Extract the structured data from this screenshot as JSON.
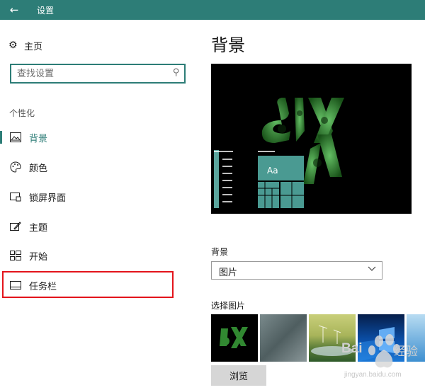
{
  "window": {
    "back_glyph": "←",
    "title": "设置"
  },
  "sidebar": {
    "home_label": "主页",
    "search_placeholder": "查找设置",
    "section_label": "个性化",
    "items": [
      {
        "label": "背景",
        "icon": "image-icon",
        "active": true
      },
      {
        "label": "颜色",
        "icon": "palette-icon",
        "active": false
      },
      {
        "label": "锁屏界面",
        "icon": "lock-screen-icon",
        "active": false
      },
      {
        "label": "主题",
        "icon": "theme-icon",
        "active": false
      },
      {
        "label": "开始",
        "icon": "start-icon",
        "active": false
      },
      {
        "label": "任务栏",
        "icon": "taskbar-icon",
        "active": false
      }
    ]
  },
  "main": {
    "page_title": "背景",
    "preview_tile_text": "Aa",
    "background_label": "背景",
    "background_select_value": "图片",
    "choose_picture_label": "选择图片",
    "browse_label": "浏览"
  },
  "watermark": {
    "brand": "Bai",
    "product": "经验",
    "url": "jingyan.baidu.com"
  },
  "colors": {
    "accent": "#2d7d77",
    "highlight": "#e3141b",
    "wallpaper_green": "#3aa03a"
  }
}
